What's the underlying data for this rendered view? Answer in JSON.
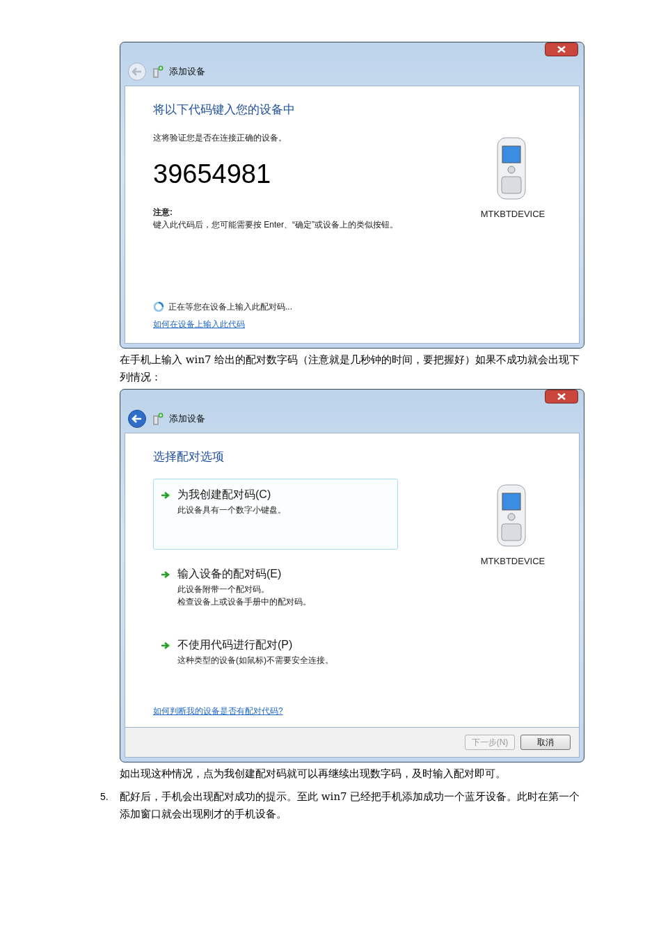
{
  "code_window": {
    "title": "添加设备",
    "back_enabled": false,
    "heading": "将以下代码键入您的设备中",
    "subtitle": "这将验证您是否在连接正确的设备。",
    "code": "39654981",
    "note_label": "注意:",
    "note_text": "键入此代码后，您可能需要按 Enter、“确定”或设备上的类似按钮。",
    "device_name": "MTKBTDEVICE",
    "status": "正在等您在设备上输入此配对码...",
    "help_link": "如何在设备上输入此代码"
  },
  "paragraph_1": "在手机上输入 win7 给出的配对数字码（注意就是几秒钟的时间，要把握好）如果不成功就会出现下列情况：",
  "options_window": {
    "title": "添加设备",
    "back_enabled": true,
    "heading": "选择配对选项",
    "options": [
      {
        "title": "为我创建配对码(C)",
        "lines": [
          "此设备具有一个数字小键盘。"
        ],
        "selected": true
      },
      {
        "title": "输入设备的配对码(E)",
        "lines": [
          "此设备附带一个配对码。",
          "检查设备上或设备手册中的配对码。"
        ],
        "selected": false
      },
      {
        "title": "不使用代码进行配对(P)",
        "lines": [
          "这种类型的设备(如鼠标)不需要安全连接。"
        ],
        "selected": false
      }
    ],
    "device_name": "MTKBTDEVICE",
    "help_link": "如何判断我的设备是否有配对代码?",
    "buttons": [
      {
        "label": "下一步(N)",
        "disabled": true
      },
      {
        "label": "取消",
        "disabled": false
      }
    ]
  },
  "paragraph_2": "如出现这种情况，点为我创建配对码就可以再继续出现数字码，及时输入配对即可。",
  "step": {
    "number": "5.",
    "text": "配好后，手机会出现配对成功的提示。至此 win7 已经把手机添加成功一个蓝牙设备。此时在第一个添加窗口就会出现刚才的手机设备。"
  }
}
